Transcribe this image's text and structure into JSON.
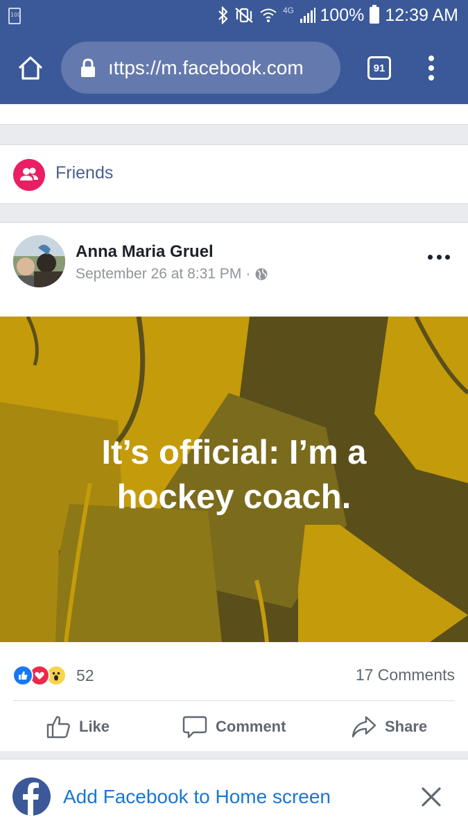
{
  "status_bar": {
    "battery_level_small": "100",
    "network_type": "4G",
    "battery_percent": "100%",
    "time": "12:39 AM"
  },
  "browser": {
    "url": "ıttps://m.facebook.com",
    "tab_count": "91",
    "theme_color": "#3b5998"
  },
  "friends_section": {
    "label": "Friends",
    "icon_color": "#e91e63"
  },
  "post": {
    "author": "Anna Maria Gruel",
    "timestamp": "September 26 at 8:31 PM",
    "separator": "·",
    "privacy_icon": "globe-icon",
    "text_line_1": "It’s official: I’m a",
    "text_line_2": "hockey coach.",
    "background_colors": [
      "#c49b0b",
      "#5a4f1a"
    ],
    "reactions": [
      "like-icon",
      "love-icon",
      "wow-icon"
    ],
    "reaction_count": "52",
    "comments_label": "17 Comments",
    "actions": {
      "like": "Like",
      "comment": "Comment",
      "share": "Share"
    }
  },
  "banner": {
    "label": "Add Facebook to Home screen",
    "link_color": "#1877d2"
  }
}
